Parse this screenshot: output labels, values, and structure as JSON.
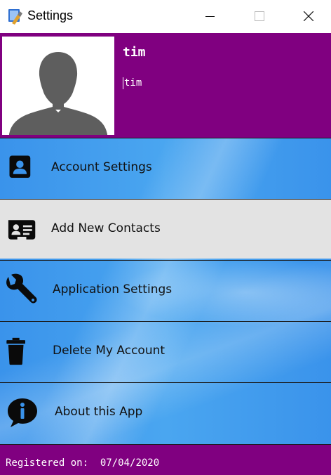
{
  "window": {
    "title": "Settings",
    "app_icon": "settings-app-icon",
    "controls": [
      "minimize-icon",
      "maximize-icon",
      "close-icon"
    ]
  },
  "profile": {
    "username": "tim",
    "name_field_value": "tim",
    "avatar_icon": "default-user-silhouette"
  },
  "menu": {
    "items": [
      {
        "label": "Account Settings",
        "icon": "account-card-icon",
        "active": false
      },
      {
        "label": "Add New Contacts",
        "icon": "contact-card-icon",
        "active": true
      },
      {
        "label": "Application Settings",
        "icon": "wrench-icon",
        "active": false
      },
      {
        "label": "Delete My Account",
        "icon": "trash-icon",
        "active": false
      },
      {
        "label": "About this App",
        "icon": "info-icon",
        "active": false
      }
    ]
  },
  "footer": {
    "registered_label": "Registered on:",
    "registered_date": "07/04/2020"
  },
  "colors": {
    "header_bg": "#800080",
    "footer_bg": "#800080",
    "menu_bg": "#3a93eb",
    "active_item_bg": "#e3e3e3"
  }
}
